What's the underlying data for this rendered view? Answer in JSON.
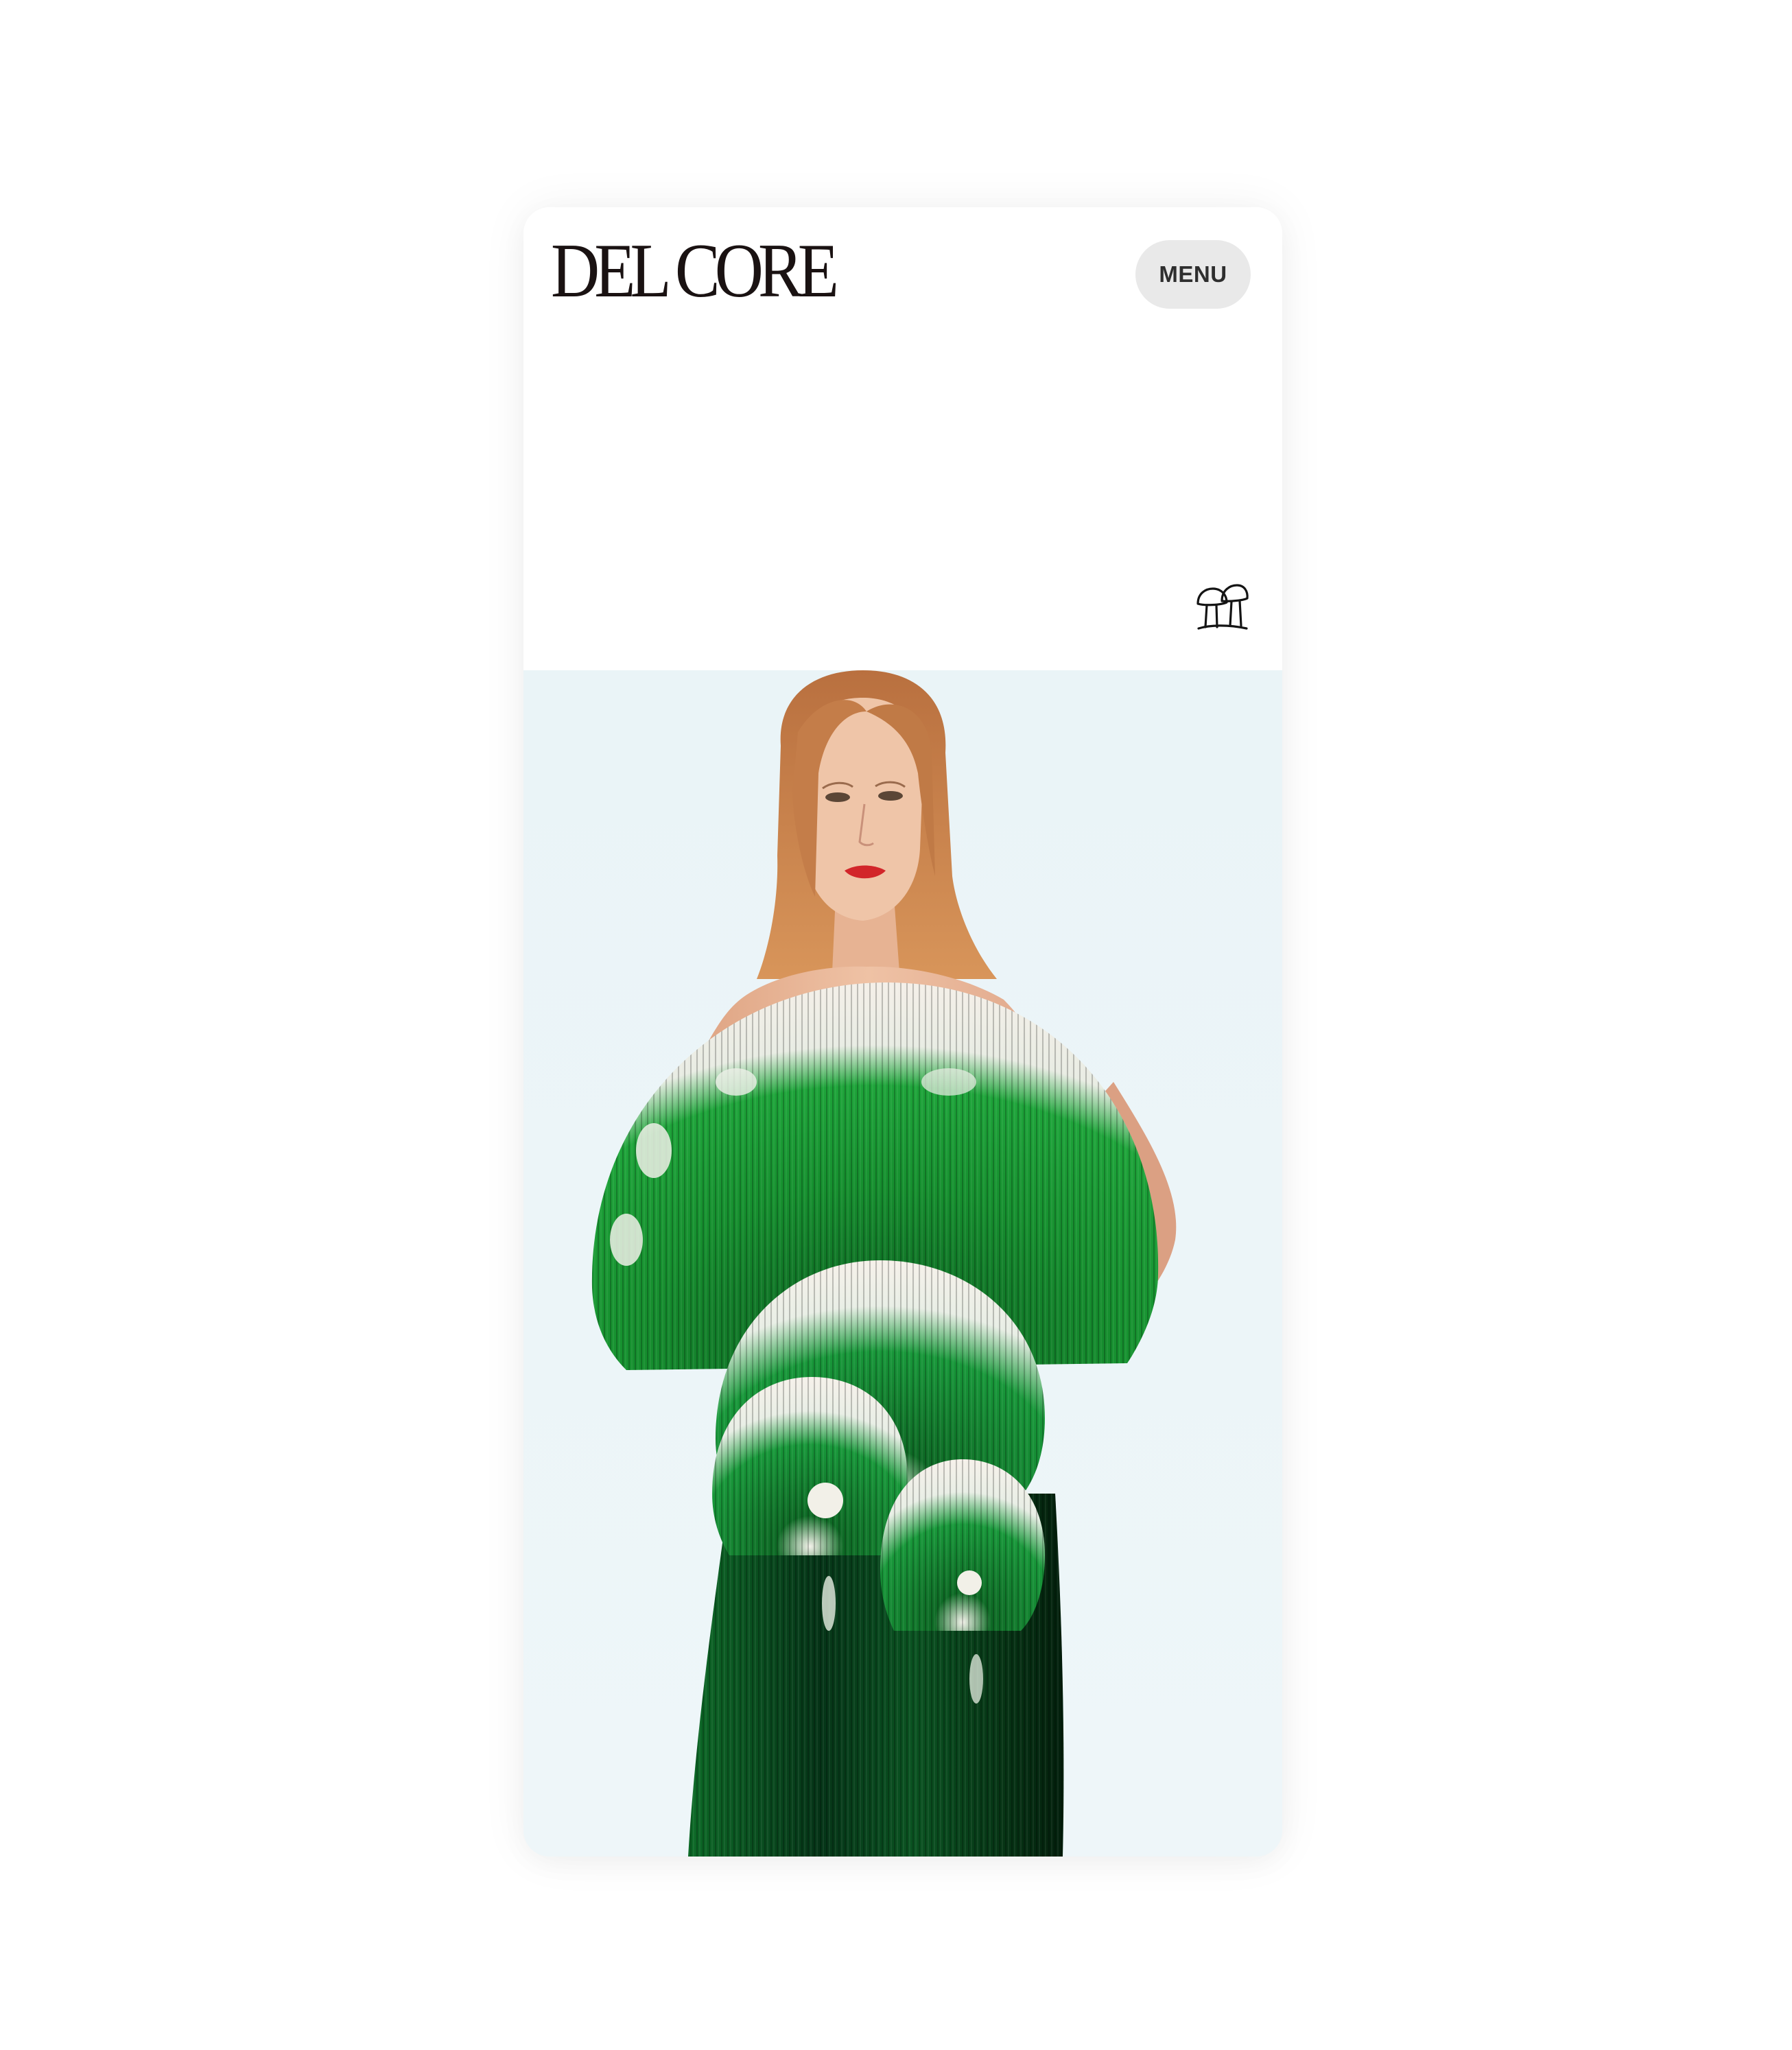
{
  "brand": {
    "logo_text": "DEL CORE"
  },
  "header": {
    "menu_label": "MENU",
    "emblem_icon": "mushroom-icon"
  },
  "hero": {
    "image_description_icon": "fashion-editorial-image"
  },
  "colors": {
    "page_background": "#ffffff",
    "menu_background": "#e9e9e9",
    "logo_color": "#1a1212",
    "hero_background": "#eaf4f7",
    "garment_green": "#127a2c"
  }
}
